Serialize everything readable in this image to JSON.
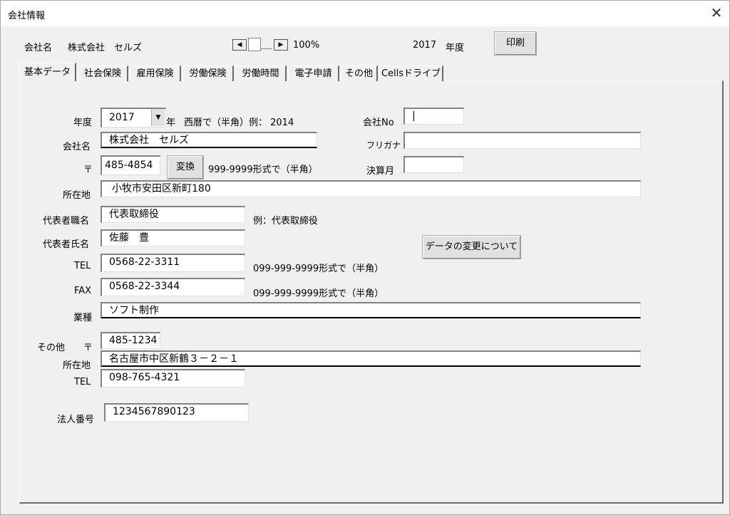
{
  "window": {
    "title": "会社情報",
    "close_glyph": "✕"
  },
  "header": {
    "company_label": "会社名",
    "company_name": "株式会社　セルズ",
    "zoom": "100%",
    "year": "2017",
    "year_suffix": "年度",
    "print_label": "印刷",
    "scroll_left_glyph": "◀",
    "scroll_right_glyph": "▶"
  },
  "tabs": [
    {
      "label": "基本データ"
    },
    {
      "label": "社会保険"
    },
    {
      "label": "雇用保険"
    },
    {
      "label": "労働保険"
    },
    {
      "label": "労働時間"
    },
    {
      "label": "電子申請"
    },
    {
      "label": "その他"
    },
    {
      "label": "Cellsドライブ"
    }
  ],
  "form": {
    "year_label": "年度",
    "year_value": "2017",
    "year_unit": "年",
    "year_hint": "西暦で（半角）例：  2014",
    "company_no_label": "会社No",
    "company_no_value": "|",
    "company_name_label": "会社名",
    "company_name_value": "株式会社　セルズ",
    "furigana_label": "フリガナ",
    "furigana_value": "",
    "postal_label": "〒",
    "postal_value": "485-4854",
    "convert_label": "変換",
    "postal_hint": "999-9999形式で（半角）",
    "fiscal_month_label": "決算月",
    "fiscal_month_value": "",
    "address_label": "所在地",
    "address_value": "小牧市安田区新町180",
    "rep_title_label": "代表者職名",
    "rep_title_value": "代表取締役",
    "rep_title_hint": "例：代表取締役",
    "rep_name_label": "代表者氏名",
    "rep_name_value": "佐藤　豊",
    "data_change_label": "データの変更について",
    "tel_label": "TEL",
    "tel_value": "0568-22-3311",
    "tel_hint": "099-999-9999形式で（半角）",
    "fax_label": "FAX",
    "fax_value": "0568-22-3344",
    "fax_hint": "099-999-9999形式で（半角）",
    "industry_label": "業種",
    "industry_value": "ソフト制作",
    "other_label": "その他",
    "other_postal_label": "〒",
    "other_postal_value": "485-1234",
    "other_address_label": "所在地",
    "other_address_value": "名古屋市中区新鶴３－２－１",
    "other_tel_label": "TEL",
    "other_tel_value": "098-765-4321",
    "corp_no_label": "法人番号",
    "corp_no_value": "1234567890123"
  }
}
